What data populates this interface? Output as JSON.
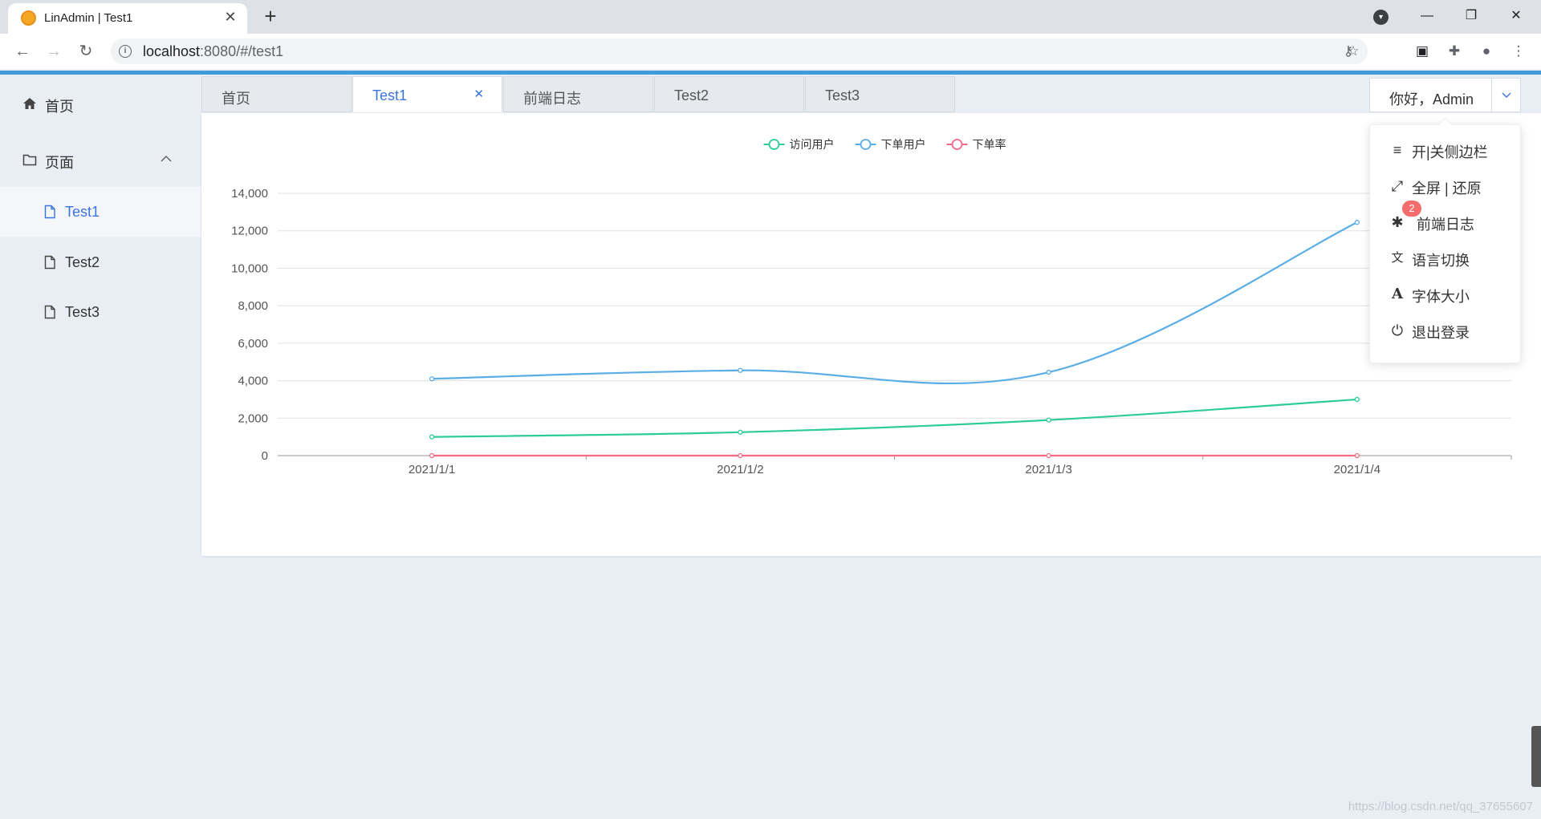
{
  "browser": {
    "tab_title": "LinAdmin | Test1",
    "url_host": "localhost",
    "url_path": ":8080/#/test1"
  },
  "sidebar": {
    "items": [
      {
        "label": "首页"
      },
      {
        "label": "页面"
      },
      {
        "label": "Test1"
      },
      {
        "label": "Test2"
      },
      {
        "label": "Test3"
      }
    ]
  },
  "tabs": [
    {
      "label": "首页"
    },
    {
      "label": "Test1"
    },
    {
      "label": "前端日志"
    },
    {
      "label": "Test2"
    },
    {
      "label": "Test3"
    }
  ],
  "user": {
    "greeting": "你好，Admin"
  },
  "dropdown": {
    "items": [
      {
        "label": "开|关侧边栏",
        "icon": "menu-icon"
      },
      {
        "label": "全屏 | 还原",
        "icon": "fullscreen-icon"
      },
      {
        "label": "前端日志",
        "icon": "bug-icon"
      },
      {
        "label": "语言切换",
        "icon": "translate-icon"
      },
      {
        "label": "字体大小",
        "icon": "font-size-icon"
      },
      {
        "label": "退出登录",
        "icon": "power-icon"
      }
    ],
    "log_badge": "2"
  },
  "chart_data": {
    "type": "line",
    "categories": [
      "2021/1/1",
      "2021/1/2",
      "2021/1/3",
      "2021/1/4"
    ],
    "series": [
      {
        "name": "访问用户",
        "color": "#2ecc9a",
        "values": [
          1000,
          1250,
          1900,
          3000
        ]
      },
      {
        "name": "下单用户",
        "color": "#5aaee5",
        "values": [
          4100,
          4550,
          4450,
          12450
        ]
      },
      {
        "name": "下单率",
        "color": "#f06b8a",
        "values": [
          0,
          0,
          0,
          0
        ]
      }
    ],
    "ylim": [
      0,
      14000
    ],
    "yticks": [
      "0",
      "2,000",
      "4,000",
      "6,000",
      "8,000",
      "10,000",
      "12,000",
      "14,000"
    ],
    "legend": "top-center",
    "smooth": true
  },
  "watermark": "https://blog.csdn.net/qq_37655607"
}
